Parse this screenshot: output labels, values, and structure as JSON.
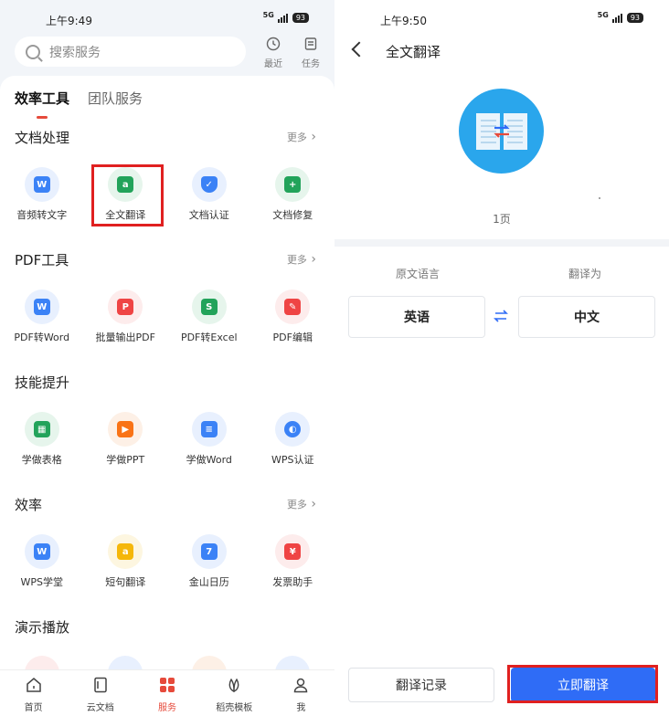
{
  "left": {
    "status": {
      "time": "上午9:49",
      "network": "5G",
      "battery": "93"
    },
    "search": {
      "placeholder": "搜索服务"
    },
    "top_actions": [
      {
        "label": "最近"
      },
      {
        "label": "任务"
      }
    ],
    "tabs": [
      {
        "label": "效率工具"
      },
      {
        "label": "团队服务"
      }
    ],
    "more_label": "更多",
    "sections": [
      {
        "title": "文档处理",
        "has_more": true,
        "items": [
          {
            "label": "音频转文字",
            "icon": "audio-to-text-icon",
            "color": "#3b82f6"
          },
          {
            "label": "全文翻译",
            "icon": "full-translate-icon",
            "color": "#22a35a"
          },
          {
            "label": "文档认证",
            "icon": "doc-certify-icon",
            "color": "#3b82f6"
          },
          {
            "label": "文档修复",
            "icon": "doc-repair-icon",
            "color": "#22a35a"
          }
        ]
      },
      {
        "title": "PDF工具",
        "has_more": true,
        "items": [
          {
            "label": "PDF转Word",
            "icon": "pdf-to-word-icon",
            "color": "#3b82f6"
          },
          {
            "label": "批量输出PDF",
            "icon": "batch-pdf-icon",
            "color": "#ef4444"
          },
          {
            "label": "PDF转Excel",
            "icon": "pdf-to-excel-icon",
            "color": "#22a35a"
          },
          {
            "label": "PDF编辑",
            "icon": "pdf-edit-icon",
            "color": "#ef4444"
          }
        ]
      },
      {
        "title": "技能提升",
        "has_more": false,
        "items": [
          {
            "label": "学做表格",
            "icon": "learn-sheet-icon",
            "color": "#22a35a"
          },
          {
            "label": "学做PPT",
            "icon": "learn-ppt-icon",
            "color": "#f97316"
          },
          {
            "label": "学做Word",
            "icon": "learn-word-icon",
            "color": "#3b82f6"
          },
          {
            "label": "WPS认证",
            "icon": "wps-cert-icon",
            "color": "#3b82f6"
          }
        ]
      },
      {
        "title": "效率",
        "has_more": true,
        "items": [
          {
            "label": "WPS学堂",
            "icon": "wps-school-icon",
            "color": "#3b82f6"
          },
          {
            "label": "短句翻译",
            "icon": "short-translate-icon",
            "color": "#f5b70a"
          },
          {
            "label": "金山日历",
            "icon": "calendar-icon",
            "color": "#3b82f6"
          },
          {
            "label": "发票助手",
            "icon": "invoice-icon",
            "color": "#ef4444"
          }
        ]
      },
      {
        "title": "演示播放",
        "has_more": false,
        "items": []
      }
    ],
    "bottom_nav": [
      {
        "label": "首页",
        "icon": "home-icon"
      },
      {
        "label": "云文档",
        "icon": "cloud-doc-icon"
      },
      {
        "label": "服务",
        "icon": "services-icon",
        "active": true
      },
      {
        "label": "稻壳模板",
        "icon": "template-icon"
      },
      {
        "label": "我",
        "icon": "profile-icon"
      }
    ]
  },
  "right": {
    "status": {
      "time": "上午9:50",
      "network": "5G",
      "battery": "93"
    },
    "title": "全文翻译",
    "pages": "1页",
    "source_label": "原文语言",
    "target_label": "翻译为",
    "source_lang": "英语",
    "target_lang": "中文",
    "history_button": "翻译记录",
    "translate_button": "立即翻译"
  },
  "colors": {
    "accent": "#e64a3b",
    "primary": "#2f6cf6",
    "highlight": "#e02020"
  }
}
